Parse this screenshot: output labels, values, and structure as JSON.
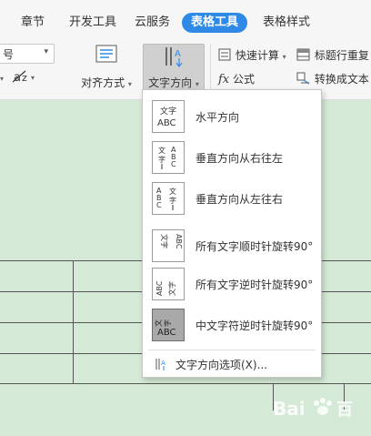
{
  "tabs": [
    {
      "label": "章节",
      "active": false
    },
    {
      "label": "开发工具",
      "active": false
    },
    {
      "label": "云服务",
      "active": false
    },
    {
      "label": "表格工具",
      "active": true
    },
    {
      "label": "表格样式",
      "active": false
    }
  ],
  "ribbon": {
    "font_combo_value": "号",
    "align_label": "对齐方式",
    "text_direction_label": "文字方向",
    "quick_calc_label": "快速计算",
    "formula_label": "公式",
    "repeat_title_label": "标题行重复",
    "convert_text_label": "转换成文本"
  },
  "menu": {
    "items": [
      {
        "label": "水平方向",
        "selected": false
      },
      {
        "label": "垂直方向从右往左",
        "selected": false
      },
      {
        "label": "垂直方向从左往右",
        "selected": false
      },
      {
        "label": "所有文字顺时针旋转90°",
        "selected": false
      },
      {
        "label": "所有文字逆时针旋转90°",
        "selected": false
      },
      {
        "label": "中文字符逆时针旋转90°",
        "selected": true
      }
    ],
    "options_label": "文字方向选项(X)..."
  },
  "watermark": {
    "text": "Bai",
    "text2": "百"
  },
  "colors": {
    "accent": "#2e8ae6",
    "table_bg": "#d5ead6",
    "ribbon_bg": "#f6f6f6"
  }
}
